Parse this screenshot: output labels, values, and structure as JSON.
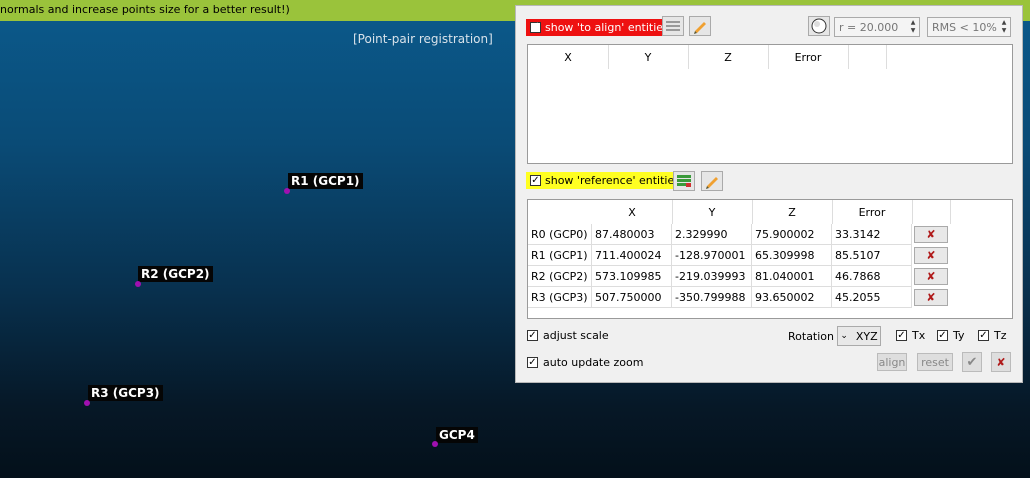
{
  "banner": {
    "text": "normals and increase points size for a better result!)"
  },
  "scene": {
    "title": "[Point-pair registration]",
    "points": [
      {
        "label": "R1 (GCP1)"
      },
      {
        "label": "R2 (GCP2)"
      },
      {
        "label": "R3 (GCP3)"
      },
      {
        "label": "GCP4"
      }
    ]
  },
  "dialog": {
    "to_align": {
      "label": "show 'to align' entities",
      "checked": true
    },
    "radius": {
      "value": "r = 20.000"
    },
    "rms": {
      "value": "RMS < 10%"
    },
    "align_table": {
      "headers": [
        "X",
        "Y",
        "Z",
        "Error"
      ]
    },
    "reference": {
      "label": "show 'reference' entities",
      "checked": true
    },
    "ref_table": {
      "headers": [
        "X",
        "Y",
        "Z",
        "Error"
      ],
      "rows": [
        {
          "name": "R0 (GCP0)",
          "x": "87.480003",
          "y": "2.329990",
          "z": "75.900002",
          "err": "33.3142"
        },
        {
          "name": "R1 (GCP1)",
          "x": "711.400024",
          "y": "-128.970001",
          "z": "65.309998",
          "err": "85.5107"
        },
        {
          "name": "R2 (GCP2)",
          "x": "573.109985",
          "y": "-219.039993",
          "z": "81.040001",
          "err": "46.7868"
        },
        {
          "name": "R3 (GCP3)",
          "x": "507.750000",
          "y": "-350.799988",
          "z": "93.650002",
          "err": "45.2055"
        }
      ],
      "delete_glyph": "✘"
    },
    "adjust_scale": {
      "label": "adjust scale",
      "checked": true
    },
    "rotation": {
      "label": "Rotation",
      "value": "XYZ"
    },
    "translations": [
      {
        "label": "Tx",
        "checked": true
      },
      {
        "label": "Ty",
        "checked": true
      },
      {
        "label": "Tz",
        "checked": true
      }
    ],
    "auto_zoom": {
      "label": "auto update zoom",
      "checked": true
    },
    "buttons": {
      "align": "align",
      "reset": "reset",
      "ok_glyph": "✔",
      "cancel_glyph": "✘"
    }
  }
}
